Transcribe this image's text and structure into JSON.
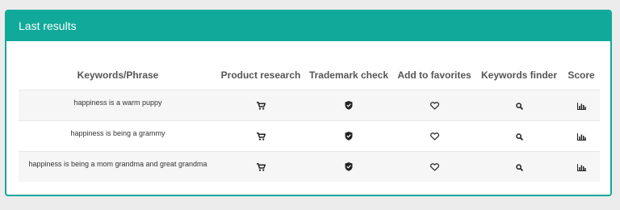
{
  "panel": {
    "title": "Last results",
    "accent_color": "#10a99a"
  },
  "table": {
    "headers": [
      "Keywords/Phrase",
      "Product research",
      "Trademark check",
      "Add to favorites",
      "Keywords finder",
      "Score"
    ],
    "action_icons": [
      "cart-icon",
      "shield-check-icon",
      "heart-icon",
      "search-icon",
      "bar-chart-icon"
    ],
    "rows": [
      {
        "keyword": "happiness is a warm puppy"
      },
      {
        "keyword": "happiness is being a grammy"
      },
      {
        "keyword": "happiness is being a mom grandma and great grandma"
      }
    ]
  }
}
